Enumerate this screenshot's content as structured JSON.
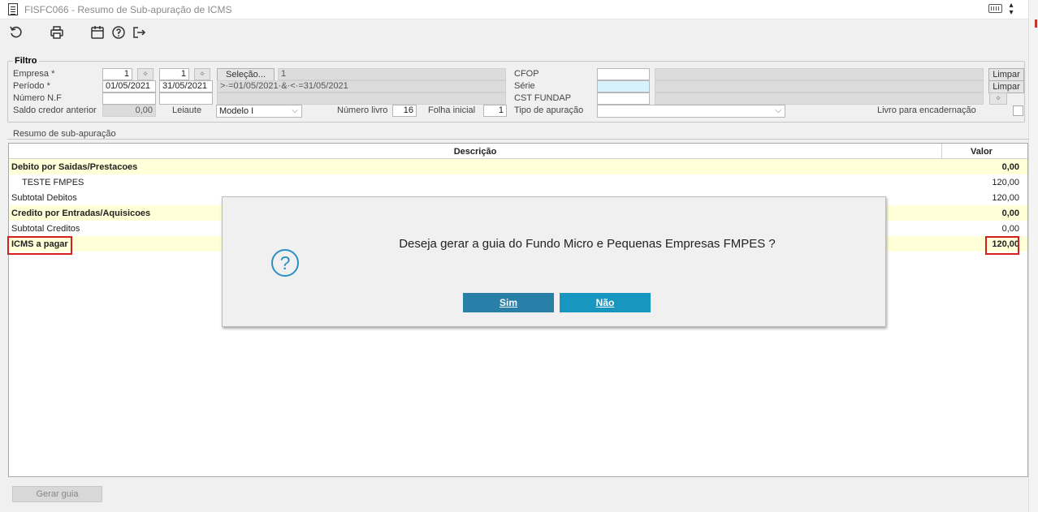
{
  "window": {
    "title": "FISFC066 - Resumo de Sub-apuração de ICMS",
    "icons": [
      "document-icon",
      "keyboard-icon",
      "menu-arrows-icon"
    ]
  },
  "toolbar": {
    "icons": [
      "refresh-icon",
      "print-icon",
      "calendar-icon",
      "help-icon",
      "exit-icon"
    ]
  },
  "filter": {
    "legend": "Filtro",
    "empresa_label": "Empresa *",
    "empresa_from": "1",
    "empresa_to": "1",
    "periodo_label": "Período *",
    "periodo_from": "01/05/2021",
    "periodo_to": "31/05/2021",
    "numero_nf_label": "Número N.F",
    "saldo_label": "Saldo credor anterior",
    "saldo_value": "0,00",
    "leiaute_label": "Leiaute",
    "leiaute_value": "Modelo I",
    "numero_livro_label": "Número livro",
    "numero_livro_value": "16",
    "folha_inicial_label": "Folha inicial",
    "folha_inicial_value": "1",
    "selecao_button": "Seleção...",
    "selecao_value": "1",
    "periodo_expr": ">·=01/05/2021·&·<·=31/05/2021",
    "cfop_label": "CFOP",
    "serie_label": "Série",
    "cst_label": "CST FUNDAP",
    "tipo_apuracao_label": "Tipo de apuração",
    "limpar1": "Limpar",
    "limpar2": "Limpar",
    "livro_enc_label": "Livro para encadernação"
  },
  "section": {
    "title": "Resumo de sub-apuração"
  },
  "grid": {
    "col_desc": "Descrição",
    "col_val": "Valor",
    "rows": [
      {
        "desc": "Debito por Saidas/Prestacoes",
        "value": "0,00"
      },
      {
        "desc": "TESTE FMPES",
        "value": "120,00"
      },
      {
        "desc": "Subtotal Debitos",
        "value": "120,00"
      },
      {
        "desc": "Credito por Entradas/Aquisicoes",
        "value": "0,00"
      },
      {
        "desc": "Subtotal Creditos",
        "value": "0,00"
      },
      {
        "desc": "ICMS a pagar",
        "value": "120,00"
      }
    ]
  },
  "bottom": {
    "gerar_guia": "Gerar guia"
  },
  "dialog": {
    "message": "Deseja gerar a guia do Fundo Micro e Pequenas Empresas FMPES ?",
    "yes": "Sim",
    "no": "Não",
    "icon": "question-icon",
    "accent_color": "#2a8fc4",
    "button_color": "#1f86ad"
  },
  "highlight_color": "#d61f1f"
}
